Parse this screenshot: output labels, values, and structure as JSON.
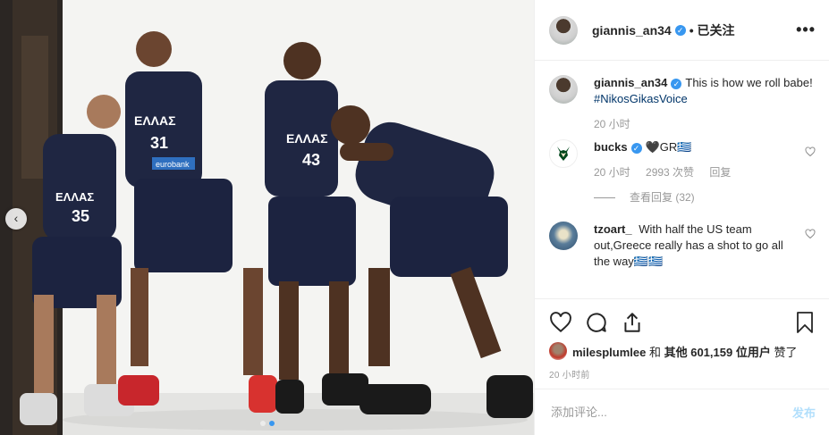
{
  "post": {
    "author": "giannis_an34",
    "follow_status": "• 已关注",
    "more_label": "•••",
    "caption": {
      "username": "giannis_an34",
      "text": "This is how we roll babe!",
      "hashtag": "#NikosGikasVoice",
      "time": "20 小时"
    },
    "comments": [
      {
        "username": "bucks",
        "text": "🖤GR🇬🇷",
        "time": "20 小时",
        "likes": "2993 次赞",
        "reply_label": "回复",
        "view_replies": "查看回复 (32)"
      },
      {
        "username": "tzoart_",
        "text": "With half the US team out,Greece really has a shot to go all the way🇬🇷🇬🇷"
      }
    ],
    "likes": {
      "user": "milesplumlee",
      "text_mid": " 和 ",
      "text_rest": "其他 601,159 位用户",
      "text_end": " 赞了"
    },
    "timestamp": "20 小时前",
    "add_comment_placeholder": "添加评论...",
    "post_label": "发布",
    "carousel": {
      "nav_glyph": "‹"
    }
  },
  "photo": {
    "jersey_text": "ΕΛΛΑΣ",
    "sponsor": "eurobank",
    "numbers": [
      "35",
      "31",
      "43",
      ""
    ]
  },
  "colors": {
    "accent": "#3897f0",
    "text": "#262626",
    "muted": "#999999",
    "link": "#003569",
    "post_disabled": "#b2dffc"
  }
}
